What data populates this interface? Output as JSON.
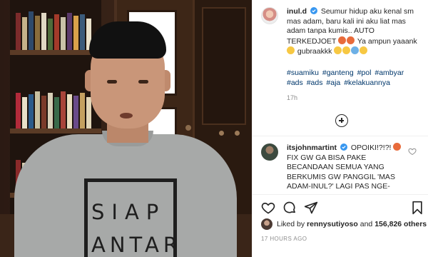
{
  "post": {
    "username": "inul.d",
    "caption": "Seumur hidup aku kenal sm mas adam, baru kali ini aku liat mas adam tanpa kumis.. AUTO TERKEDJOET",
    "caption_tail": "Ya ampun yaaank",
    "caption_end": "gubraakkk",
    "hashtags": [
      "#suamiku",
      "#ganteng",
      "#pol",
      "#ambyar",
      "#ads",
      "#ads",
      "#aja",
      "#kelakuannya"
    ],
    "time_short": "17h",
    "shirt_print": [
      "SIAP",
      "ANTAR"
    ]
  },
  "comment": {
    "username": "itsjohnmartint",
    "text": "OPOIKI!?!?!",
    "text_body": "FIX GW GA BISA PAKE BECANDAAN SEMUA YANG BERKUMIS GW PANGGIL 'MAS ADAM-INUL?' LAGI PAS NGE-"
  },
  "likes": {
    "prefix": "Liked by",
    "user": "rennysutiyoso",
    "middle": "and",
    "count": "156,826 others"
  },
  "timestamp": "17 HOURS AGO",
  "icons": {
    "like": "heart-icon",
    "comment": "comment-icon",
    "share": "paper-plane-icon",
    "save": "bookmark-icon",
    "load_more": "plus-circle-icon",
    "verified": "verified-badge-icon"
  },
  "colors": {
    "verified": "#3897f0",
    "hashtag": "#00376b",
    "muted": "#8e8e8e"
  }
}
